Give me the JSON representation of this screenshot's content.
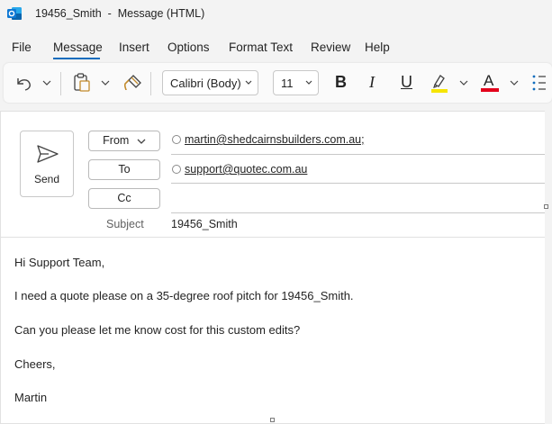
{
  "window": {
    "title": "19456_Smith  -  Message (HTML)"
  },
  "menu": {
    "items": [
      "File",
      "Message",
      "Insert",
      "Options",
      "Format Text",
      "Review",
      "Help"
    ],
    "active": "Message"
  },
  "ribbon": {
    "font_name": "Calibri (Body)",
    "font_size": "11",
    "bold": "B",
    "italic": "I",
    "underline": "U",
    "font_color_letter": "A",
    "highlight_color": "#f6e500",
    "font_color": "#e3001b"
  },
  "header": {
    "send_label": "Send",
    "from_label": "From",
    "to_label": "To",
    "cc_label": "Cc",
    "from_address": "martin@shedcairnsbuilders.com.au;",
    "to_address": "support@quotec.com.au",
    "subject_label": "Subject",
    "subject_value": "19456_Smith"
  },
  "body": {
    "lines": [
      "Hi Support Team,",
      "I need a quote please on a 35-degree roof pitch for 19456_Smith.",
      "Can you please let me know cost for this custom edits?",
      "Cheers,",
      "Martin"
    ]
  },
  "colors": {
    "accent": "#0f6cbd",
    "outlook_blue": "#0f78d4"
  }
}
